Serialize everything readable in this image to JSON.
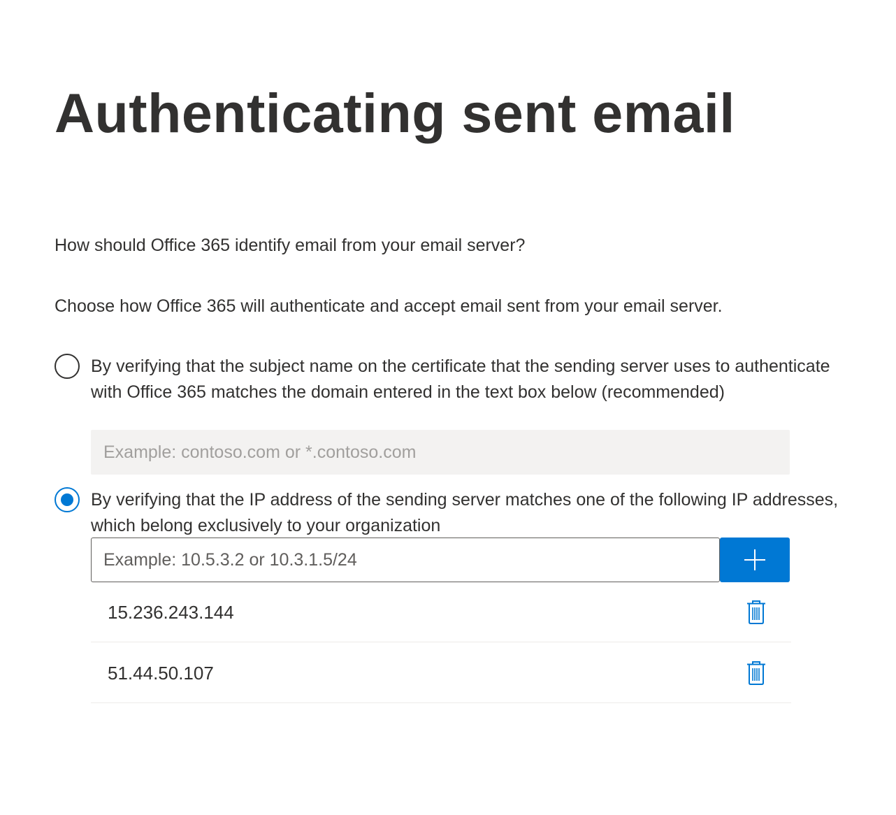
{
  "page": {
    "title": "Authenticating sent email",
    "question": "How should Office 365 identify email from your email server?",
    "instruction": "Choose how Office 365 will authenticate and accept email sent from your email server."
  },
  "options": {
    "certificate": {
      "label": "By verifying that the subject name on the certificate that the sending server uses to authenticate with Office 365 matches the domain entered in the text box below (recommended)",
      "selected": false,
      "domain_value": "",
      "domain_placeholder": "Example: contoso.com or *.contoso.com"
    },
    "ip": {
      "label": "By verifying that the IP address of the sending server matches one of the following IP addresses, which belong exclusively to your organization",
      "selected": true,
      "ip_value": "",
      "ip_placeholder": "Example: 10.5.3.2 or 10.3.1.5/24",
      "add_icon": "plus-icon",
      "delete_icon": "trash-icon",
      "addresses": [
        "15.236.243.144",
        "51.44.50.107"
      ]
    }
  },
  "colors": {
    "accent": "#0078d4",
    "text": "#323130",
    "input_background": "#f3f2f1",
    "divider": "#edebe9"
  }
}
